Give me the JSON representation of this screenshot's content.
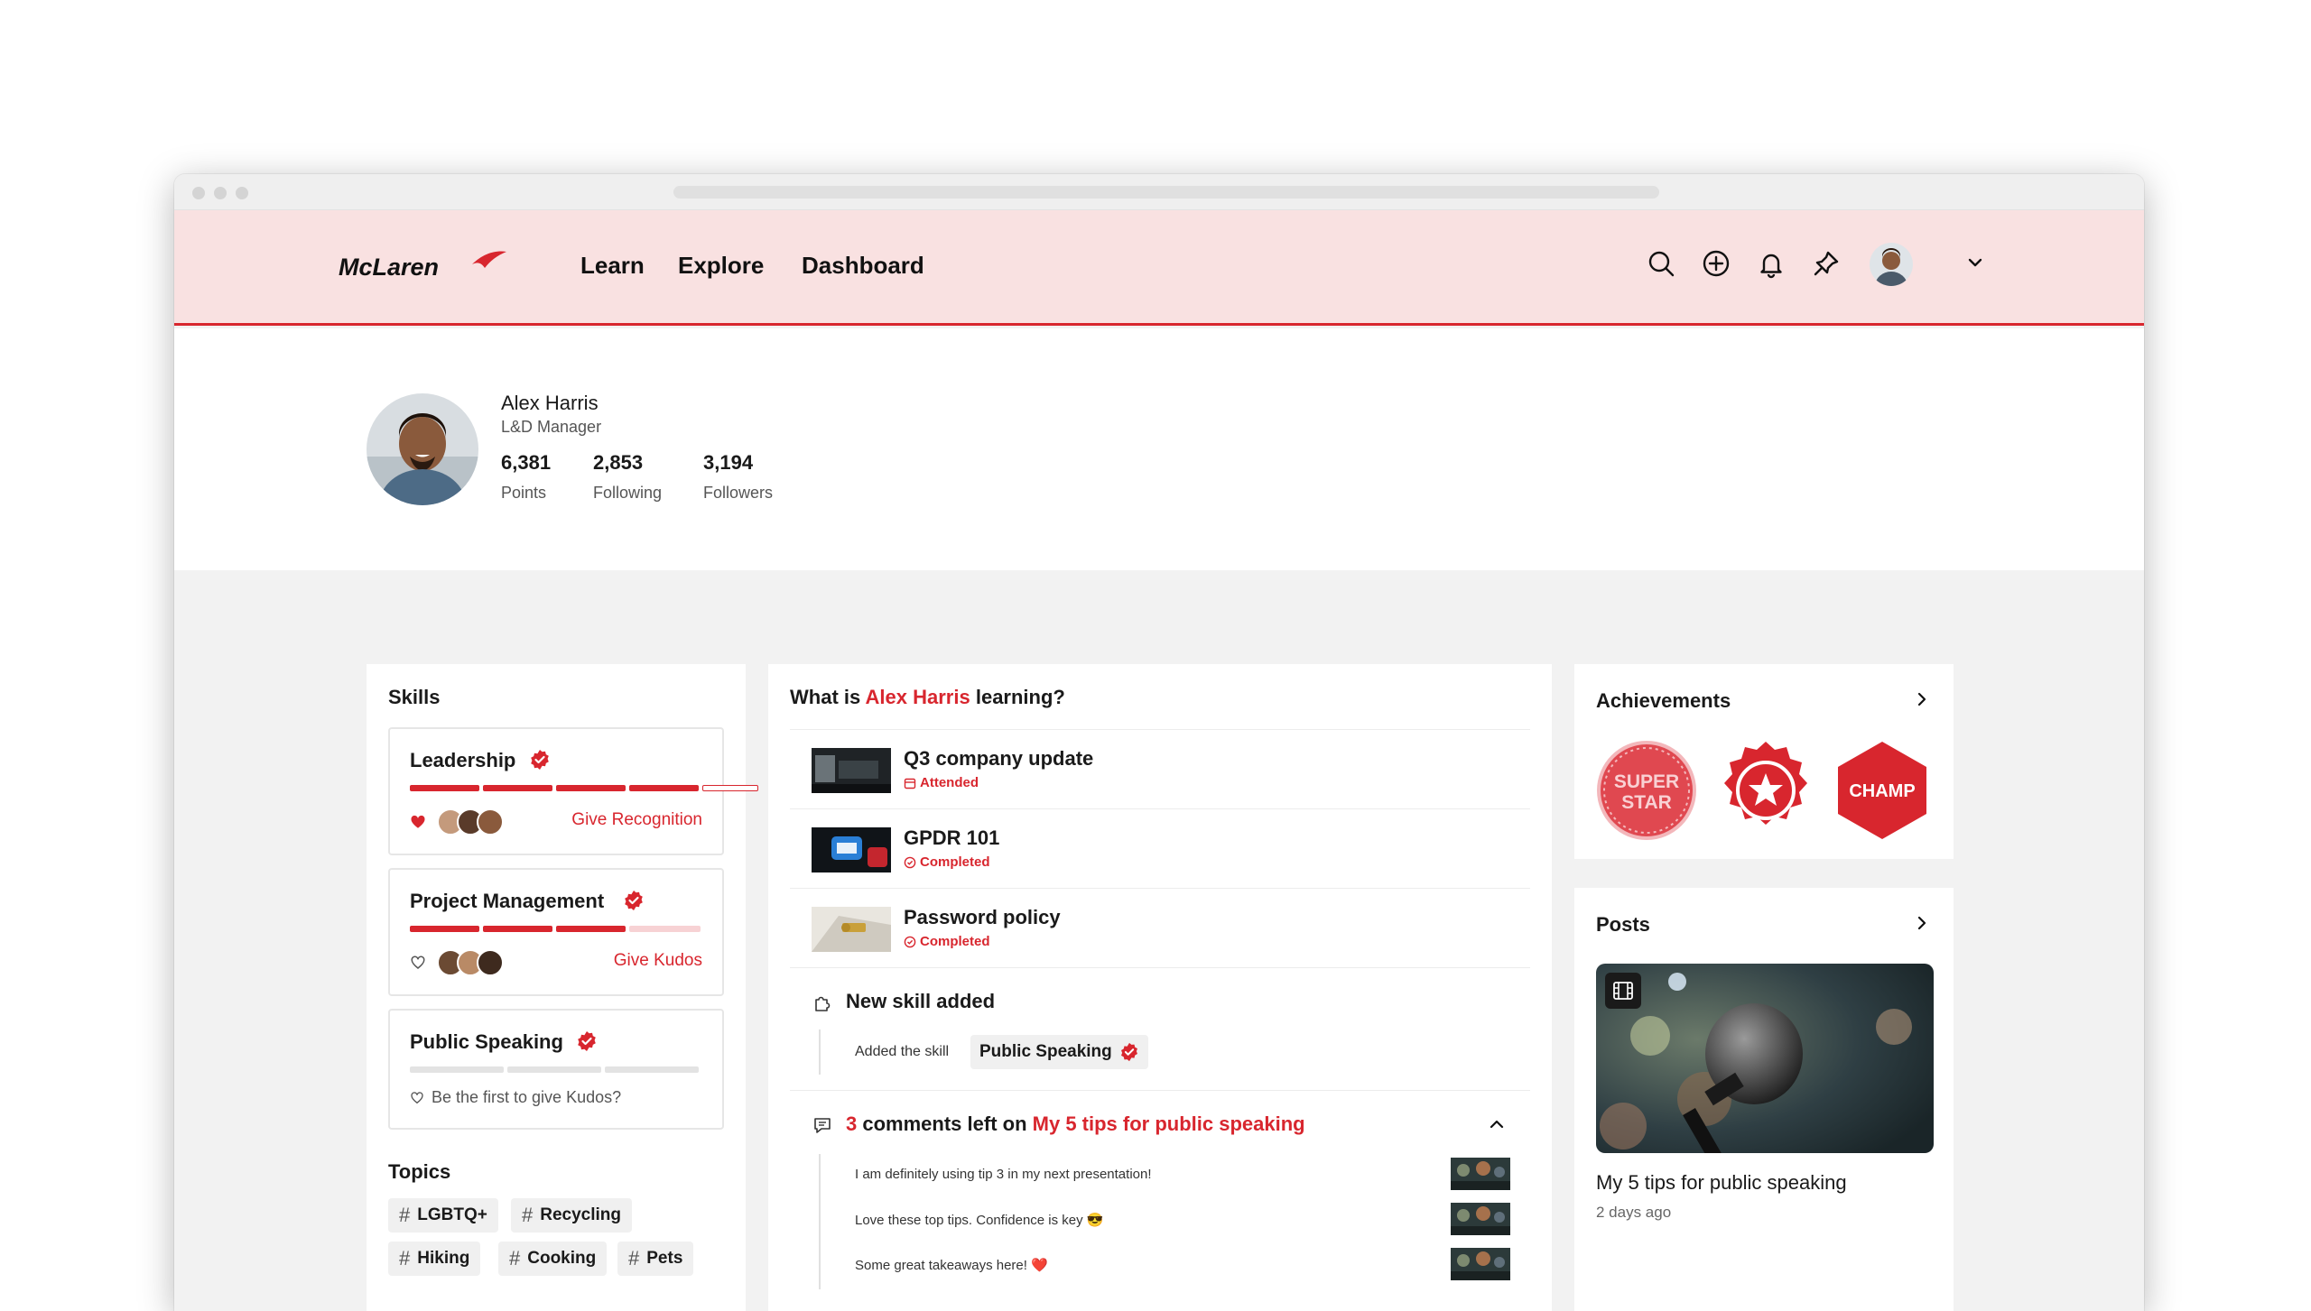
{
  "nav": {
    "logo_text": "McLaren",
    "links": [
      "Learn",
      "Explore",
      "Dashboard"
    ],
    "icons": [
      "search-icon",
      "add-circle-icon",
      "bell-icon",
      "pin-icon",
      "avatar",
      "chevron-down-icon"
    ]
  },
  "profile": {
    "name": "Alex Harris",
    "role": "L&D Manager",
    "stats": [
      {
        "value": "6,381",
        "label": "Points"
      },
      {
        "value": "2,853",
        "label": "Following"
      },
      {
        "value": "3,194",
        "label": "Followers"
      }
    ]
  },
  "skills": {
    "title": "Skills",
    "items": [
      {
        "name": "Leadership",
        "level": 4,
        "of": 5,
        "action": "Give Recognition",
        "liked": true
      },
      {
        "name": "Project Management",
        "level": 3,
        "of": 4,
        "action": "Give Kudos",
        "liked": false
      },
      {
        "name": "Public Speaking",
        "level": 0,
        "of": 3,
        "action": "Be the first to give Kudos?",
        "liked": false
      }
    ]
  },
  "topics": {
    "title": "Topics",
    "items": [
      "LGBTQ+",
      "Recycling",
      "Hiking",
      "Cooking",
      "Pets"
    ]
  },
  "feed": {
    "heading_prefix": "What is",
    "heading_name": "Alex Harris",
    "heading_suffix": "learning?",
    "items": [
      {
        "title": "Q3 company update",
        "status": "Attended",
        "status_icon": "calendar-icon"
      },
      {
        "title": "GPDR 101",
        "status": "Completed",
        "status_icon": "check-circle-icon"
      },
      {
        "title": "Password policy",
        "status": "Completed",
        "status_icon": "check-circle-icon"
      }
    ],
    "new_skill": {
      "title": "New skill added",
      "prefix": "Added the skill",
      "skill": "Public Speaking"
    },
    "comments": {
      "count": "3",
      "middle": "comments left on",
      "post": "My 5 tips for public speaking",
      "list": [
        "I am definitely using tip 3 in my next presentation!",
        "Love these top tips. Confidence is key 😎",
        "Some great takeaways here! ❤️"
      ]
    }
  },
  "achievements": {
    "title": "Achievements",
    "badges": [
      "SUPER",
      "STAR",
      "CHAMP"
    ]
  },
  "posts": {
    "title": "Posts",
    "post_title": "My 5 tips for public speaking",
    "post_time": "2 days ago"
  },
  "colors": {
    "accent": "#d8262e",
    "nav_bg": "#f9e1e1",
    "page_bg": "#f2f2f2"
  }
}
